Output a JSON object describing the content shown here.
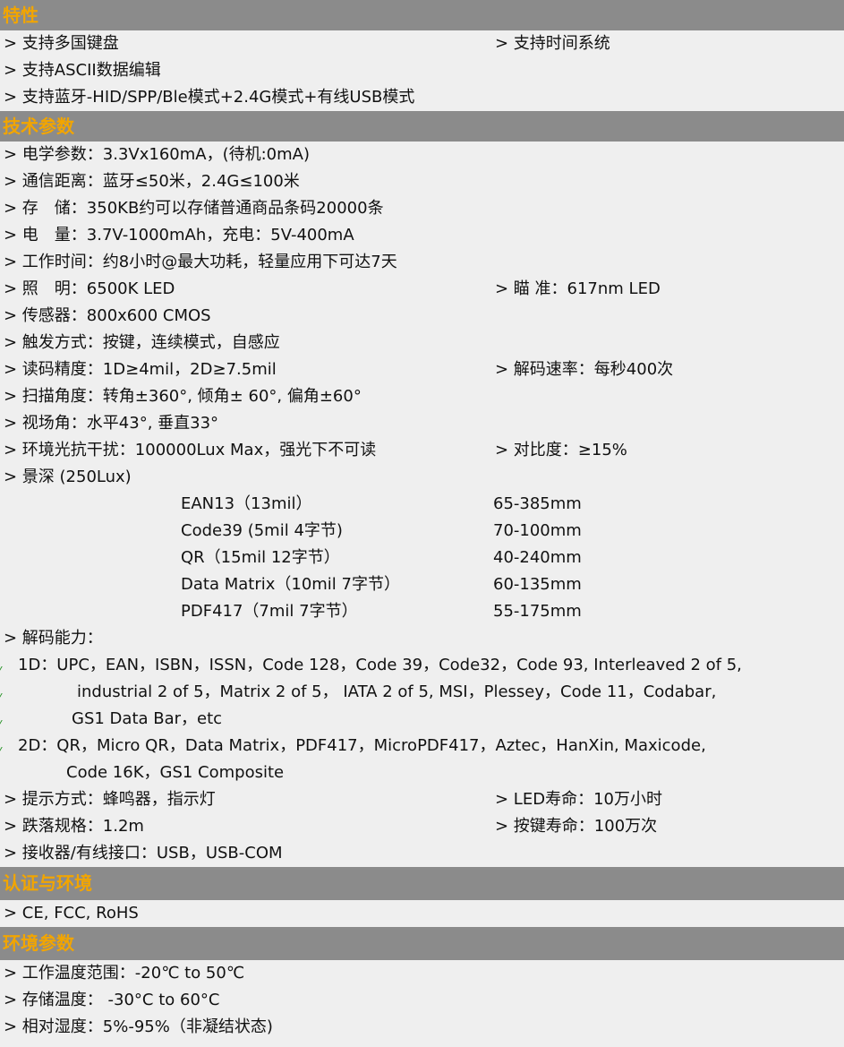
{
  "sections": {
    "features": {
      "title": "特性"
    },
    "specs": {
      "title": "技术参数"
    },
    "certs": {
      "title": "认证与环境"
    },
    "env": {
      "title": "环境参数"
    }
  },
  "features": {
    "r1": "> 支持多国键盘",
    "r1b": "> 支持时间系统",
    "r2": "> 支持ASCII数据编辑",
    "r3": "> 支持蓝牙-HID/SPP/Ble模式+2.4G模式+有线USB模式"
  },
  "specs": {
    "electrical": "> 电学参数：3.3Vx160mA，(待机:0mA)",
    "distance": "> 通信距离：蓝牙≤50米，2.4G≤100米",
    "storage": "> 存　储：350KB约可以存储普通商品条码20000条",
    "battery": "> 电　量：3.7V-1000mAh，充电：5V-400mA",
    "worktime": "> 工作时间：约8小时@最大功耗，轻量应用下可达7天",
    "illum": "> 照　明：6500K LED",
    "aim": "> 瞄  准：617nm LED",
    "sensor": "> 传感器：800x600 CMOS",
    "trigger": "> 触发方式：按键，连续模式，自感应",
    "precision": "> 读码精度：1D≥4mil，2D≥7.5mil",
    "speed": "> 解码速率：每秒400次",
    "angle": "> 扫描角度：转角±360°, 倾角± 60°, 偏角±60°",
    "fov": "> 视场角：水平43°, 垂直33°",
    "ambient": "> 环境光抗干扰：100000Lux Max，强光下不可读",
    "contrast": "> 对比度：≥15%",
    "dof_title": "> 景深 (250Lux)",
    "dof": [
      {
        "label": "EAN13（13mil）",
        "value": "65-385mm"
      },
      {
        "label": "Code39 (5mil 4字节)",
        "value": "70-100mm"
      },
      {
        "label": "QR（15mil 12字节）",
        "value": "40-240mm"
      },
      {
        "label": "Data Matrix（10mil 7字节）",
        "value": "60-135mm"
      },
      {
        "label": "PDF417（7mil 7字节）",
        "value": "55-175mm"
      }
    ],
    "decode_title": "> 解码能力：",
    "decode_1d_a": "1D：UPC，EAN，ISBN，ISSN，Code 128，Code 39，Code32，Code 93, Interleaved 2 of 5,",
    "decode_1d_b": "industrial 2 of 5，Matrix 2 of 5， IATA 2 of 5, MSI，Plessey，Code 11，Codabar,",
    "decode_1d_c": "GS1 Data Bar，etc",
    "decode_2d_a": "2D：QR，Micro QR，Data Matrix，PDF417，MicroPDF417，Aztec，HanXin, Maxicode,",
    "decode_2d_b": "Code 16K，GS1 Composite",
    "prompt": "> 提示方式：蜂鸣器，指示灯",
    "led_life": "> LED寿命：10万小时",
    "drop": "> 跌落规格：1.2m",
    "key_life": "> 按键寿命：100万次",
    "interface": "> 接收器/有线接口：USB，USB-COM"
  },
  "certs": {
    "list": "> CE, FCC, RoHS"
  },
  "env": {
    "op_temp": "> 工作温度范围：-20℃ to 50℃",
    "st_temp": "> 存储温度： -30°C to 60°C",
    "humidity": "> 相对湿度：5%-95%（非凝结状态)"
  },
  "colors": {
    "header_bg": "#8b8b8b",
    "header_text": "#f2a500",
    "page_bg": "#efefef"
  }
}
